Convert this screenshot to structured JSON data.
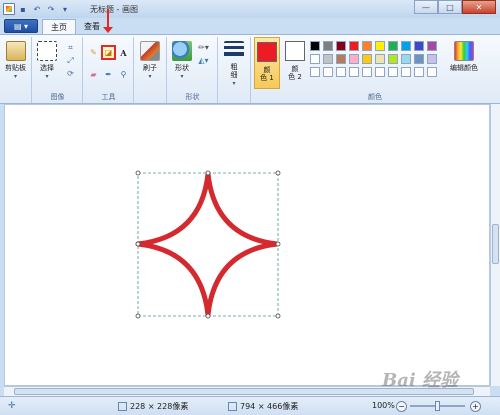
{
  "titlebar": {
    "title": "无标题 - 画图",
    "minimize": "—",
    "maximize": "□",
    "close": "✕"
  },
  "tabs": {
    "file": "▤ ▾",
    "home": "主页",
    "view": "查看"
  },
  "ribbon": {
    "clipboard": {
      "label": "剪贴板",
      "group": ""
    },
    "image": {
      "select": "选择",
      "group": "图像"
    },
    "tools": {
      "group": "工具",
      "text": "A"
    },
    "brushes": {
      "label": "刷子"
    },
    "shapes": {
      "label": "形状",
      "group": "形状"
    },
    "size": {
      "label": "粗\n细"
    },
    "color1": {
      "label": "颜\n色 1"
    },
    "color2": {
      "label": "颜\n色 2"
    },
    "edit_colors": {
      "label": "编辑颜色"
    },
    "colors_group": "颜色"
  },
  "palette": [
    [
      "#000000",
      "#7f7f7f",
      "#880015",
      "#ed1c24",
      "#ff7f27",
      "#fff200",
      "#22b14c",
      "#00a2e8",
      "#3f48cc",
      "#a349a4"
    ],
    [
      "#ffffff",
      "#c3c3c3",
      "#b97a57",
      "#ffaec9",
      "#ffc90e",
      "#efe4b0",
      "#b5e61d",
      "#99d9ea",
      "#7092be",
      "#c8bfe7"
    ],
    [
      "#ffffff",
      "#ffffff",
      "#ffffff",
      "#ffffff",
      "#ffffff",
      "#ffffff",
      "#ffffff",
      "#ffffff",
      "#ffffff",
      "#ffffff"
    ]
  ],
  "colors": {
    "accent": "#e02a2a",
    "star": "#d42a2f",
    "ribbon_bg": "#dfeaf7"
  },
  "status": {
    "selection_size": "228 × 228像素",
    "image_size": "794 × 466像素",
    "zoom": "100%"
  },
  "watermark": "Bai 经验"
}
